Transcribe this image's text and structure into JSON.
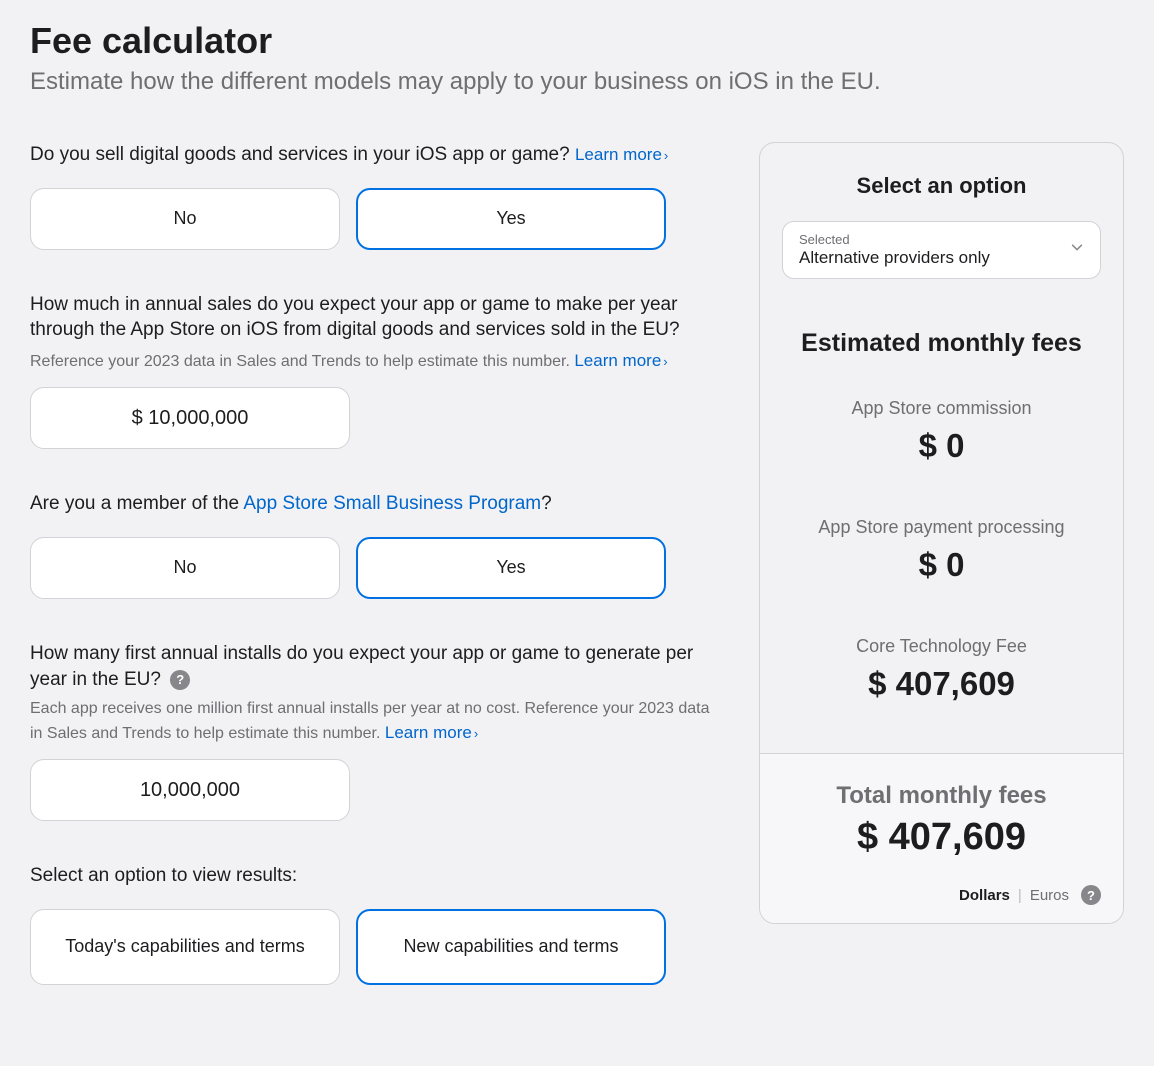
{
  "header": {
    "title": "Fee calculator",
    "subtitle": "Estimate how the different models may apply to your business on iOS in the EU."
  },
  "learn_more": "Learn more",
  "q1": {
    "question": "Do you sell digital goods and services in your iOS app or game?",
    "no": "No",
    "yes": "Yes"
  },
  "q2": {
    "question": "How much in annual sales do you expect your app or game to make per year through the App Store on iOS from digital goods and services sold in the EU?",
    "helper": "Reference your 2023 data in Sales and Trends to help estimate this number.",
    "value": "$ 10,000,000"
  },
  "q3": {
    "prefix": "Are you a member of the ",
    "link": "App Store Small Business Program",
    "suffix": "?",
    "no": "No",
    "yes": "Yes"
  },
  "q4": {
    "question": "How many first annual installs do you expect your app or game to generate per year in the EU?",
    "helper": "Each app receives one million first annual installs per year at no cost. Reference your 2023 data in Sales and Trends to help estimate this number.",
    "value": "10,000,000"
  },
  "q5": {
    "question": "Select an option to view results:",
    "today": "Today's capabilities and terms",
    "new": "New capabilities and terms"
  },
  "sidebar": {
    "title": "Select an option",
    "select_label": "Selected",
    "select_value": "Alternative providers only",
    "est_title": "Estimated monthly fees",
    "fees": {
      "commission_label": "App Store commission",
      "commission_value": "$ 0",
      "processing_label": "App Store payment processing",
      "processing_value": "$ 0",
      "ctf_label": "Core Technology Fee",
      "ctf_value": "$ 407,609"
    },
    "total_label": "Total monthly fees",
    "total_value": "$ 407,609",
    "currency_dollars": "Dollars",
    "currency_euros": "Euros"
  }
}
